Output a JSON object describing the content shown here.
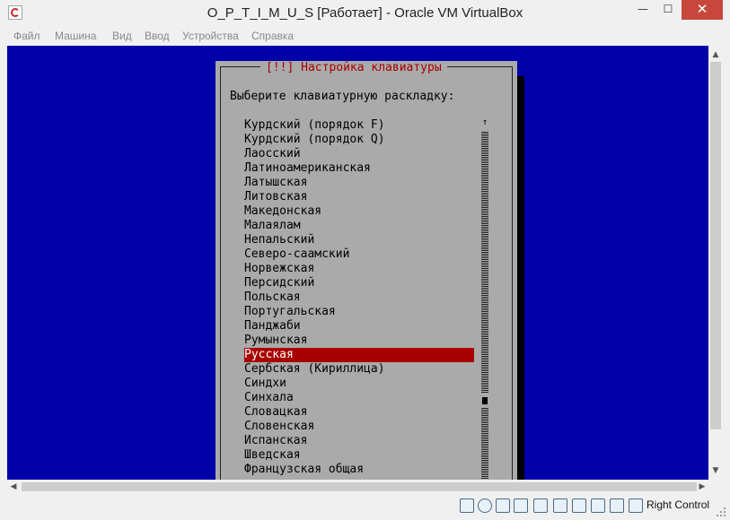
{
  "window": {
    "title": "O_P_T_I_M_U_S [Работает] - Oracle VM VirtualBox",
    "minimize": "—",
    "maximize": "☐",
    "close": "✕"
  },
  "menubar": {
    "items": [
      "Файл",
      "Машина",
      "Вид",
      "Ввод",
      "Устройства",
      "Справка"
    ]
  },
  "dialog": {
    "title": "[!!] Настройка клавиатуры",
    "prompt": "Выберите клавиатурную раскладку:",
    "scroll_arrow": "↑",
    "selected_index": 16,
    "layouts": [
      "Курдский (порядок F)",
      "Курдский (порядок Q)",
      "Лаосский",
      "Латиноамериканская",
      "Латышская",
      "Литовская",
      "Македонская",
      "Малаялам",
      "Непальский",
      "Северо-саамский",
      "Норвежская",
      "Персидский",
      "Польская",
      "Португальская",
      "Панджаби",
      "Румынская",
      "Русская",
      "Сербская (Кириллица)",
      "Синдхи",
      "Синхала",
      "Словацкая",
      "Словенская",
      "Испанская",
      "Шведская",
      "Французская общая"
    ],
    "colors": {
      "dialog_bg": "#AAAAAA",
      "screen_bg": "#0000A8",
      "highlight": "#A80000"
    }
  },
  "statusbar": {
    "host_key": "Right Control",
    "icons": [
      "hard-disk-icon",
      "optical-drive-icon",
      "network-icon",
      "usb-icon",
      "shared-folders-icon",
      "display-icon",
      "video-capture-icon",
      "mouse-integration-icon",
      "keyboard-capture-icon",
      "host-key-arrow-icon"
    ]
  },
  "scrollbars": {
    "up": "▲",
    "down": "▼",
    "left": "◀",
    "right": "▶"
  }
}
